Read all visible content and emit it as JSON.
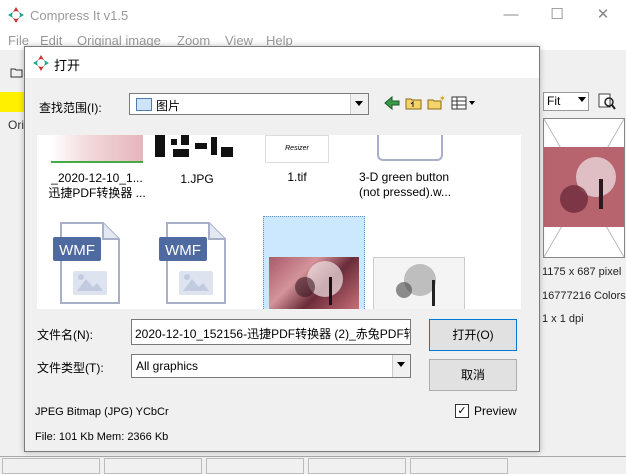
{
  "main_window": {
    "title": "Compress It v1.5",
    "menu": [
      "File",
      "Edit",
      "Original image",
      "Zoom",
      "View",
      "Help"
    ],
    "orig_label": "Orig",
    "zoom_select": "Fit",
    "image_info": {
      "dimensions": "1175 x 687 pixel",
      "colors": "16777216 Colors",
      "dpi": "1 x 1 dpi"
    }
  },
  "dialog": {
    "title": "打开",
    "look_in_label": "查找范围(I):",
    "look_in_value": "图片",
    "files": [
      {
        "name": "_2020-12-10_1...\n迅捷PDF转换器 ...",
        "type": "image"
      },
      {
        "name": "1.JPG",
        "type": "image"
      },
      {
        "name": "1.tif",
        "type": "image"
      },
      {
        "name": "3-D green button\n(not pressed).w...",
        "type": "wmf"
      },
      {
        "name": "",
        "type": "wmf"
      },
      {
        "name": "",
        "type": "wmf"
      },
      {
        "name": "",
        "type": "image"
      },
      {
        "name": "",
        "type": "image"
      }
    ],
    "wmf_badge": "WMF",
    "filename_label": "文件名(N):",
    "filename_value": "2020-12-10_152156-迅捷PDF转换器 (2)_赤兔PDF转",
    "filetype_label": "文件类型(T):",
    "filetype_value": "All graphics",
    "open_button": "打开(O)",
    "cancel_button": "取消",
    "preview_label": "Preview",
    "preview_checked": "✓",
    "format_info": "JPEG Bitmap (JPG) YCbCr",
    "file_info": "File: 101 Kb   Mem: 2366 Kb"
  }
}
